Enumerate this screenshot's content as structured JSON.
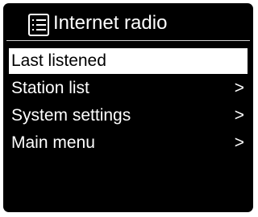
{
  "header": {
    "title": "Internet radio",
    "icon": "list-icon"
  },
  "menu": {
    "items": [
      {
        "label": "Last listened",
        "arrow": "",
        "selected": true
      },
      {
        "label": "Station list",
        "arrow": ">",
        "selected": false
      },
      {
        "label": "System settings",
        "arrow": ">",
        "selected": false
      },
      {
        "label": "Main menu",
        "arrow": ">",
        "selected": false
      }
    ]
  },
  "colors": {
    "background": "#000000",
    "foreground": "#ffffff",
    "highlight": "#ffffff"
  }
}
